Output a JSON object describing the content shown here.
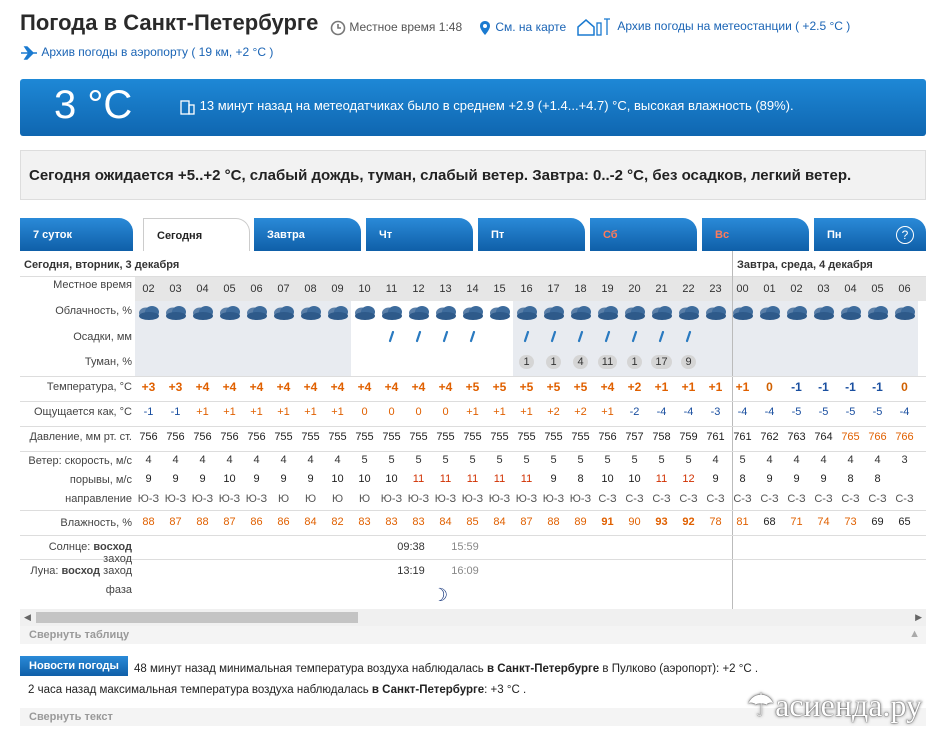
{
  "header": {
    "title": "Погода в Санкт-Петербурге",
    "local_time_label": "Местное время",
    "local_time": "1:48",
    "map_link": "См. на карте",
    "archive_station": "Архив погоды на метеостанции ( +2.5 °C )",
    "archive_airport": "Архив погоды в аэропорту ( 19 км, +2 °C )"
  },
  "current": {
    "temp": "3 °C",
    "info": "13 минут назад на метеодатчиках было в среднем +2.9 (+1.4...+4.7) °C, высокая влажность (89%)."
  },
  "expect": "Сегодня ожидается +5..+2 °C, слабый дождь, туман, слабый ветер. Завтра: 0..-2 °C, без осадков, легкий ветер.",
  "tabs": [
    "7 суток",
    "Сегодня",
    "Завтра",
    "Чт",
    "Пт",
    "Сб",
    "Вс",
    "Пн"
  ],
  "help": "?",
  "days": {
    "today": "Сегодня, вторник, 3 декабря",
    "tomorrow": "Завтра, среда, 4 декабря"
  },
  "labels": {
    "time": "Местное время",
    "clouds": "Облачность, %",
    "precip": "Осадки, мм",
    "fog": "Туман, %",
    "temp": "Температура, °C",
    "feels": "Ощущается как, °C",
    "pressure": "Давление, мм рт. ст.",
    "wind": "Ветер: скорость, м/с",
    "gusts": "порывы, м/с",
    "dir": "направление",
    "humidity": "Влажность, %",
    "sun_a": "Солнце: ",
    "sun_b": "восход",
    "sun_c": " заход",
    "moon_a": "Луна: ",
    "moon_b": "восход",
    "moon_c": " заход",
    "phase": "фаза"
  },
  "hours": [
    "02",
    "03",
    "04",
    "05",
    "06",
    "07",
    "08",
    "09",
    "10",
    "11",
    "12",
    "13",
    "14",
    "15",
    "16",
    "17",
    "18",
    "19",
    "20",
    "21",
    "22",
    "23",
    "00",
    "01",
    "02",
    "03",
    "04",
    "05",
    "06"
  ],
  "precip_marks": [
    "",
    "",
    "",
    "",
    "",
    "",
    "",
    "",
    "",
    "1",
    "1",
    "1",
    "1",
    "",
    "1",
    "1",
    "1",
    "1",
    "1",
    "1",
    "1",
    "",
    "",
    "",
    "",
    "",
    "",
    "",
    ""
  ],
  "fog": [
    "",
    "",
    "",
    "",
    "",
    "",
    "",
    "",
    "",
    "",
    "",
    "",
    "",
    "",
    "1",
    "1",
    "4",
    "11",
    "1",
    "17",
    "9",
    "",
    "",
    "",
    "",
    "",
    "",
    "",
    ""
  ],
  "temp": [
    "+3",
    "+3",
    "+4",
    "+4",
    "+4",
    "+4",
    "+4",
    "+4",
    "+4",
    "+4",
    "+4",
    "+4",
    "+5",
    "+5",
    "+5",
    "+5",
    "+5",
    "+4",
    "+2",
    "+1",
    "+1",
    "+1",
    "+1",
    "0",
    "-1",
    "-1",
    "-1",
    "-1",
    "0"
  ],
  "feels": [
    "-1",
    "-1",
    "+1",
    "+1",
    "+1",
    "+1",
    "+1",
    "+1",
    "0",
    "0",
    "0",
    "0",
    "+1",
    "+1",
    "+1",
    "+2",
    "+2",
    "+1",
    "-2",
    "-4",
    "-4",
    "-3",
    "-4",
    "-4",
    "-5",
    "-5",
    "-5",
    "-5",
    "-4"
  ],
  "pressure": [
    "756",
    "756",
    "756",
    "756",
    "756",
    "755",
    "755",
    "755",
    "755",
    "755",
    "755",
    "755",
    "755",
    "755",
    "755",
    "755",
    "755",
    "756",
    "757",
    "758",
    "759",
    "761",
    "761",
    "762",
    "763",
    "764",
    "765",
    "766",
    "766"
  ],
  "wind": [
    "4",
    "4",
    "4",
    "4",
    "4",
    "4",
    "4",
    "4",
    "5",
    "5",
    "5",
    "5",
    "5",
    "5",
    "5",
    "5",
    "5",
    "5",
    "5",
    "5",
    "5",
    "4",
    "5",
    "4",
    "4",
    "4",
    "4",
    "4",
    "3"
  ],
  "gusts": [
    "9",
    "9",
    "9",
    "10",
    "9",
    "9",
    "9",
    "10",
    "10",
    "10",
    "11",
    "11",
    "11",
    "11",
    "11",
    "9",
    "8",
    "10",
    "10",
    "11",
    "12",
    "9",
    "8",
    "9",
    "9",
    "9",
    "8",
    "8",
    ""
  ],
  "dir": [
    "Ю-З",
    "Ю-З",
    "Ю-З",
    "Ю-З",
    "Ю-З",
    "Ю",
    "Ю",
    "Ю",
    "Ю",
    "Ю-З",
    "Ю-З",
    "Ю-З",
    "Ю-З",
    "Ю-З",
    "Ю-З",
    "Ю-З",
    "Ю-З",
    "С-З",
    "С-З",
    "С-З",
    "С-З",
    "С-З",
    "С-З",
    "С-З",
    "С-З",
    "С-З",
    "С-З",
    "С-З",
    "С-З"
  ],
  "humidity": [
    "88",
    "87",
    "88",
    "87",
    "86",
    "86",
    "84",
    "82",
    "83",
    "83",
    "83",
    "84",
    "85",
    "84",
    "87",
    "88",
    "89",
    "91",
    "90",
    "93",
    "92",
    "78",
    "81",
    "68",
    "71",
    "74",
    "73",
    "69",
    "65"
  ],
  "sun": {
    "rise": "09:38",
    "set": "15:59"
  },
  "moon": {
    "rise": "13:19",
    "set": "16:09"
  },
  "moon_icon": "moon-crescent-icon",
  "collapse_table": "Свернуть таблицу",
  "news": {
    "badge": "Новости погоды",
    "line1_a": "48 минут назад минимальная температура воздуха наблюдалась ",
    "line1_b": "в Санкт-Петербурге",
    "line1_c": " в Пулково (аэропорт): +2 °C .",
    "line2_a": "2 часа назад максимальная температура воздуха наблюдалась ",
    "line2_b": "в Санкт-Петербурге",
    "line2_c": ": +3 °C .",
    "collapse": "Свернуть текст"
  },
  "watermark": "асиенда.ру",
  "colors": {
    "accent": "#0f66b0",
    "warm": "#e06000",
    "cold": "#1a4fa0",
    "highlight": "#d03000"
  }
}
